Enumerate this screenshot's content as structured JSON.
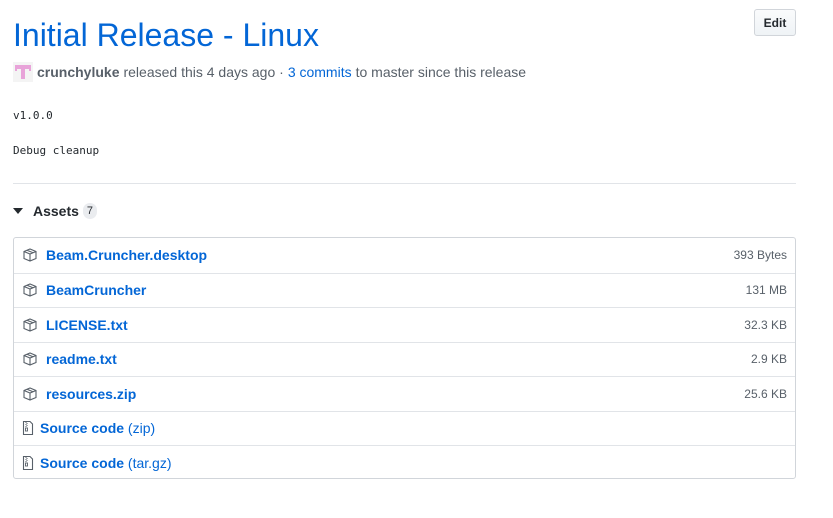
{
  "release": {
    "title": "Initial Release - Linux",
    "edit_label": "Edit",
    "author": "crunchyluke",
    "released_text": "released this 4 days ago ·",
    "commits_link": "3 commits",
    "to_branch_text": "to master since this release",
    "version": "v1.0.0",
    "notes": "Debug cleanup"
  },
  "assets": {
    "label": "Assets",
    "count": "7",
    "files": [
      {
        "name": "Beam.Cruncher.desktop",
        "size": "393 Bytes"
      },
      {
        "name": "BeamCruncher",
        "size": "131 MB"
      },
      {
        "name": "LICENSE.txt",
        "size": "32.3 KB"
      },
      {
        "name": "readme.txt",
        "size": "2.9 KB"
      },
      {
        "name": "resources.zip",
        "size": "25.6 KB"
      }
    ],
    "source": [
      {
        "label": "Source code",
        "suffix": "(zip)"
      },
      {
        "label": "Source code",
        "suffix": "(tar.gz)"
      }
    ]
  },
  "icons": {
    "avatar": "identicon-avatar",
    "package": "package-icon",
    "file_zip": "file-zip-icon",
    "caret": "triangle-down-icon"
  },
  "colors": {
    "link": "#0366d6",
    "muted": "#586069",
    "avatar": "#e8a3d9"
  }
}
